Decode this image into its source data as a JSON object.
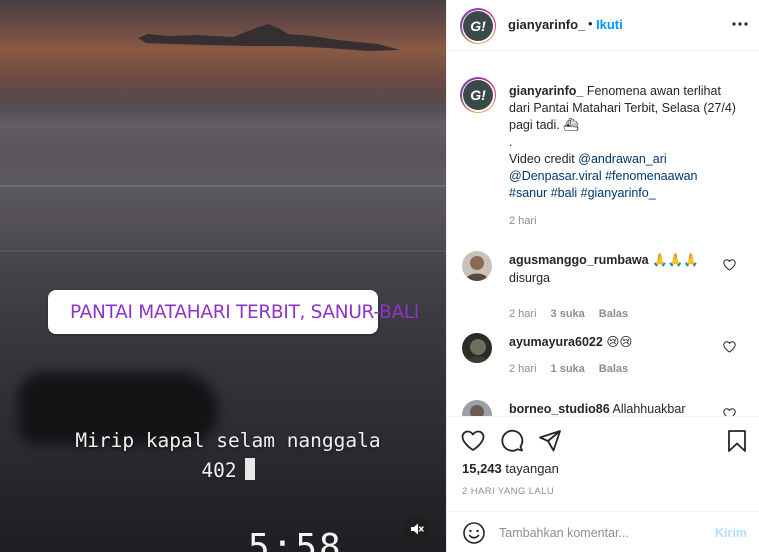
{
  "media": {
    "location_sticker": "PANTAI MATAHARI TERBIT, SANUR-BALI",
    "story_line1": "Mirip kapal selam nanggala",
    "story_line2": "402",
    "bottom_partial": "5:58"
  },
  "header": {
    "logo_letter": "G!",
    "username": "gianyarinfo_",
    "dot": "•",
    "follow_label": "Ikuti"
  },
  "caption": {
    "username": "gianyarinfo_",
    "text_part1": "Fenomena awan terlihat dari Pantai Matahari Terbit, Selasa (27/4) pagi tadi. ",
    "emoji": "⛴",
    "dot_line": ".",
    "credit_prefix": "Video credit ",
    "tags": [
      "@andrawan_ari",
      "@Denpasar.viral",
      "#fenomenaawan",
      "#sanur",
      "#bali",
      "#gianyarinfo_"
    ],
    "time": "2 hari"
  },
  "comments": [
    {
      "username": "agusmanggo_rumbawa",
      "text_inline": "🙏🙏🙏",
      "text_line2": "disurga",
      "time": "2 hari",
      "likes": "3 suka",
      "reply": "Balas"
    },
    {
      "username": "ayumayura6022",
      "text_inline": "😢😢",
      "time": "2 hari",
      "likes": "1 suka",
      "reply": "Balas"
    },
    {
      "username": "borneo_studio86",
      "text_inline": "Allahhuakbar"
    }
  ],
  "actions": {
    "views_count": "15,243",
    "views_label": "tayangan",
    "date": "2 HARI YANG LALU"
  },
  "comment_box": {
    "placeholder": "Tambahkan komentar...",
    "send_label": "Kirim"
  },
  "colors": {
    "accent_blue": "#0095f6",
    "tag_blue": "#00376b",
    "sticker_purple": "#8e34c8",
    "muted_gray": "#8e8e8e"
  },
  "icons": [
    "map-pin-icon",
    "mute-icon",
    "more-icon",
    "heart-icon",
    "comment-icon",
    "share-icon",
    "bookmark-icon",
    "emoji-icon"
  ]
}
